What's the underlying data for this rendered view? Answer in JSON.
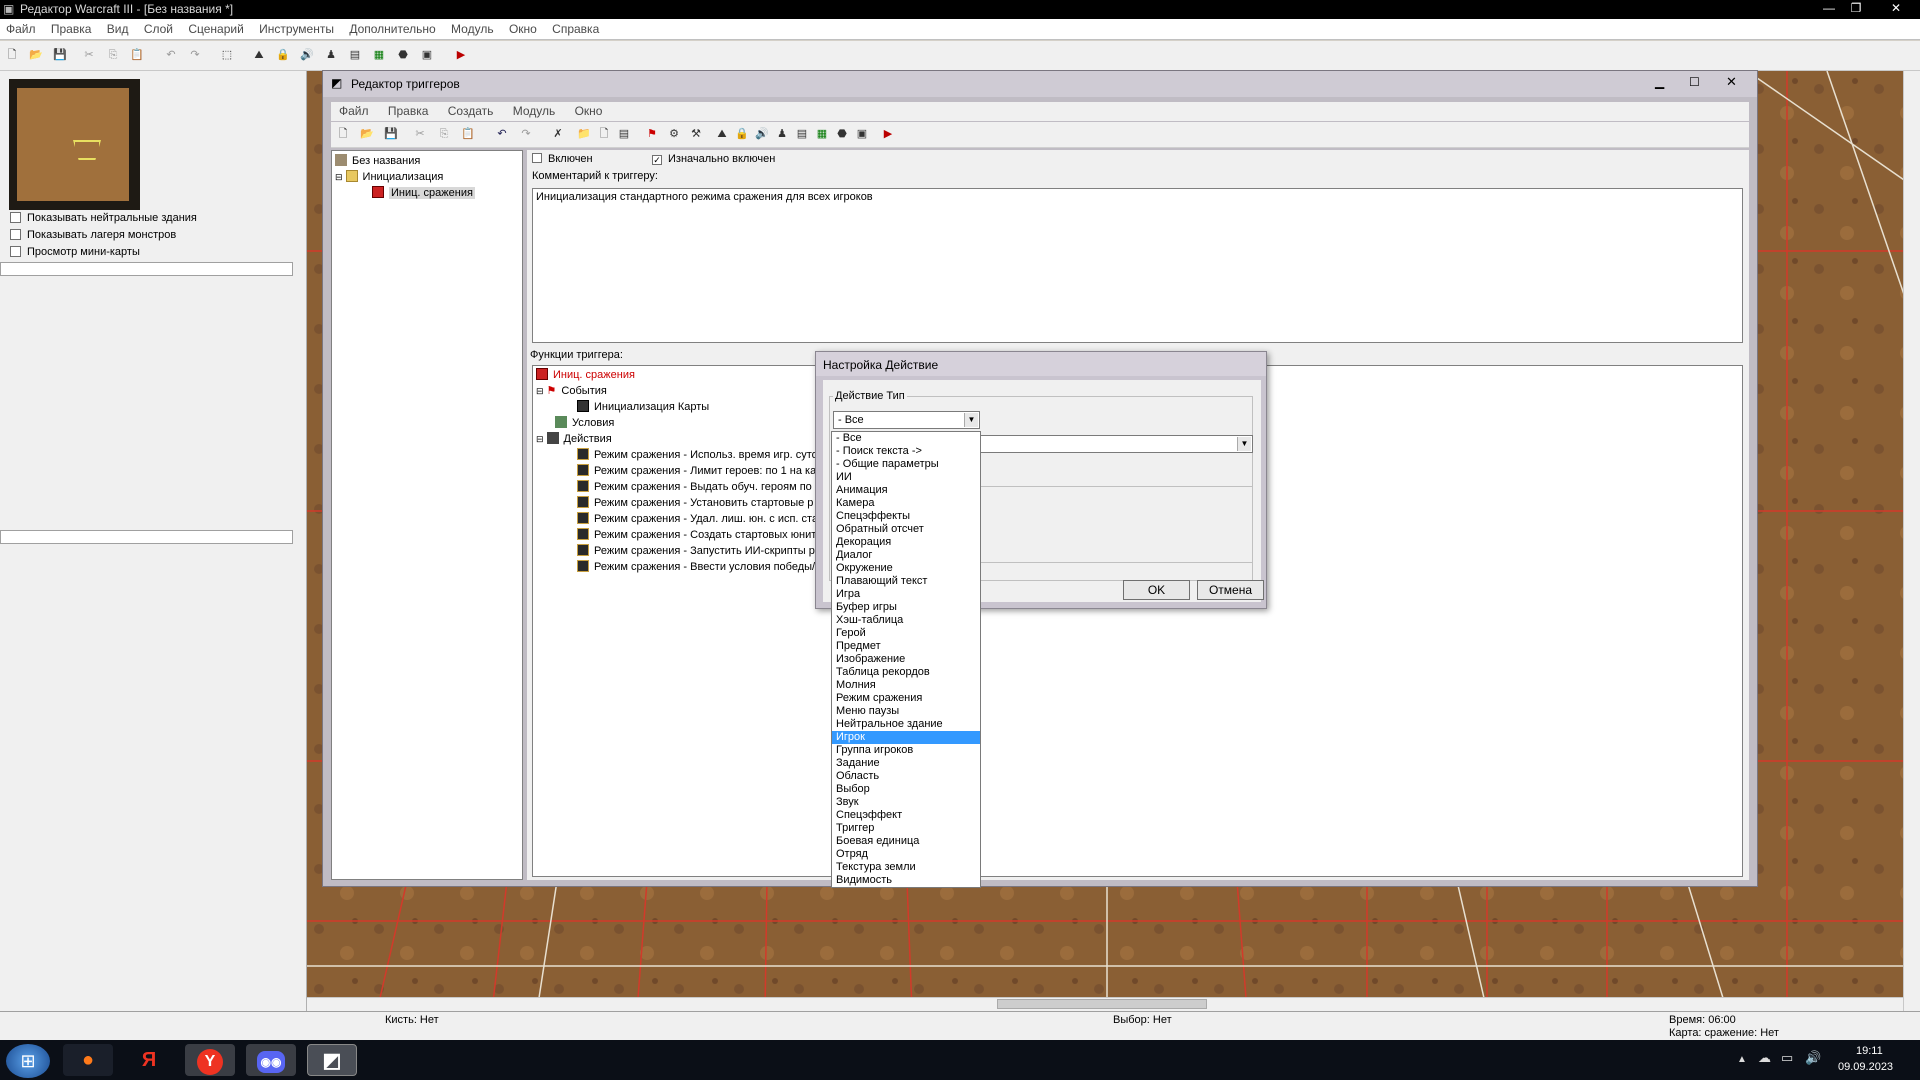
{
  "app": {
    "title": "Редактор Warcraft III - [Без названия *]",
    "menu": [
      "Файл",
      "Правка",
      "Вид",
      "Слой",
      "Сценарий",
      "Инструменты",
      "Дополнительно",
      "Модуль",
      "Окно",
      "Справка"
    ]
  },
  "left_panel": {
    "checkboxes": [
      "Показывать нейтральные здания",
      "Показывать лагеря монстров",
      "Просмотр мини-карты"
    ]
  },
  "trigger_editor": {
    "title": "Редактор триггеров",
    "menu": [
      "Файл",
      "Правка",
      "Создать",
      "Модуль",
      "Окно"
    ],
    "tree": {
      "root": "Без названия",
      "category": "Инициализация",
      "trigger": "Иниц. сражения"
    },
    "enabled_label": "Включен",
    "initially_on_label": "Изначально включен",
    "comment_label": "Комментарий к триггеру:",
    "comment_text": "Инициализация стандартного режима сражения для всех игроков",
    "functions_label": "Функции триггера:",
    "functions": {
      "trigger_name": "Иниц. сражения",
      "events_label": "События",
      "event": "Инициализация Карты",
      "conditions_label": "Условия",
      "actions_label": "Действия",
      "actions": [
        "Режим сражения - Использ. время игр. суто",
        "Режим сражения - Лимит героев: по 1 на ка",
        "Режим сражения - Выдать обуч. героям по 1",
        "Режим сражения - Установить стартовые р",
        "Режим сражения - Удал. лиш. юн. с исп. ста",
        "Режим сражения - Создать стартовых юнит",
        "Режим сражения - Запустить ИИ-скрипты р",
        "Режим сражения - Ввести условия победы/"
      ]
    }
  },
  "dialog": {
    "title": "Настройка Действие",
    "type_label": "Действие Тип",
    "selected": "- Все",
    "ok": "OK",
    "cancel": "Отмена",
    "options": [
      "- Все",
      "- Поиск текста ->",
      "- Общие параметры",
      "ИИ",
      "Анимация",
      "Камера",
      "Спецэффекты",
      "Обратный отсчет",
      "Декорация",
      "Диалог",
      "Окружение",
      "Плавающий текст",
      "Игра",
      "Буфер игры",
      "Хэш-таблица",
      "Герой",
      "Предмет",
      "Изображение",
      "Таблица рекордов",
      "Молния",
      "Режим сражения",
      "Меню паузы",
      "Нейтральное здание",
      "Игрок",
      "Группа игроков",
      "Задание",
      "Область",
      "Выбор",
      "Звук",
      "Спецэффект",
      "Триггер",
      "Боевая единица",
      "Отряд",
      "Текстура земли",
      "Видимость"
    ],
    "highlighted_option": "Игрок"
  },
  "status": {
    "brush": "Кисть: Нет",
    "selection": "Выбор: Нет",
    "time": "Время: 06:00",
    "map": "Карта: сражение: Нет"
  },
  "taskbar": {
    "clock_time": "19:11",
    "clock_date": "09.09.2023"
  },
  "colors": {
    "accent": "#3399ff",
    "trigger_red": "#cc0000",
    "terrain": "#8a5f34"
  }
}
